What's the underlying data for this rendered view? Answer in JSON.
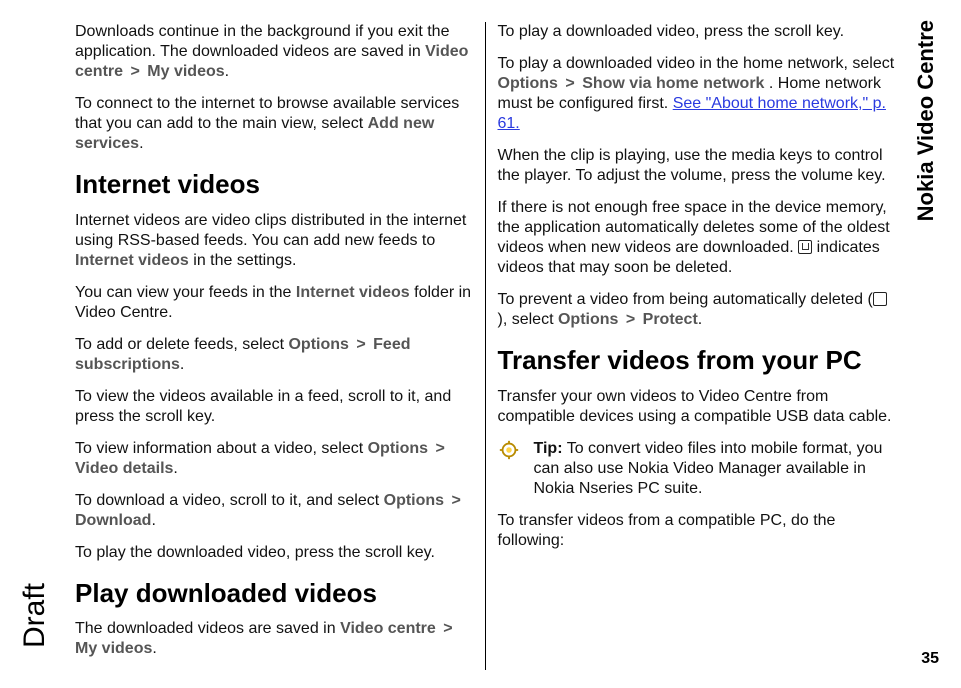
{
  "sidebar_title": "Nokia Video Centre",
  "watermark": "Draft",
  "page_number": "35",
  "left": {
    "p1_a": "Downloads continue in the background if you exit the application. The downloaded videos are saved in ",
    "p1_b": "Video centre",
    "p1_c": "My videos",
    "p1_d": ".",
    "p2_a": "To connect to the internet to browse available services that you can add to the main view, select ",
    "p2_b": "Add new services",
    "p2_c": ".",
    "h1": "Internet videos",
    "p3_a": "Internet videos are video clips distributed in the internet using RSS-based feeds. You can add new feeds to ",
    "p3_b": "Internet videos",
    "p3_c": " in the settings.",
    "p4_a": "You can view your feeds in the ",
    "p4_b": "Internet videos",
    "p4_c": " folder in Video Centre.",
    "p5_a": "To add or delete feeds, select ",
    "p5_b": "Options",
    "p5_c": "Feed subscriptions",
    "p5_d": ".",
    "p6": "To view the videos available in a feed, scroll to it, and press the scroll key.",
    "p7_a": "To view information about a video, select ",
    "p7_b": "Options",
    "p7_c": "Video details",
    "p7_d": ".",
    "p8_a": "To download a video, scroll to it, and select ",
    "p8_b": "Options",
    "p8_c": "Download",
    "p8_d": ".",
    "p9": "To play the downloaded video, press the scroll key.",
    "h2": "Play downloaded videos",
    "p10_a": "The downloaded videos are saved in ",
    "p10_b": "Video centre",
    "p10_c": "My videos",
    "p10_d": "."
  },
  "right": {
    "p1": "To play a downloaded video, press the scroll key.",
    "p2_a": "To play a downloaded video in the home network, select ",
    "p2_b": "Options",
    "p2_c": "Show via home network",
    "p2_d": ". Home network must be configured first. ",
    "p2_link": "See \"About home network,\" p. 61.",
    "p3": "When the clip is playing, use the media keys to control the player. To adjust the volume, press the volume key.",
    "p4_a": "If there is not enough free space in the device memory, the application automatically deletes some of the oldest videos when new videos are downloaded. ",
    "p4_b": " indicates videos that may soon be deleted.",
    "p5_a": "To prevent a video from being automatically deleted (",
    "p5_b": "), select ",
    "p5_c": "Options",
    "p5_d": "Protect",
    "p5_e": ".",
    "h1": "Transfer videos from your PC",
    "p6": "Transfer your own videos to Video Centre from compatible devices using a compatible USB data cable.",
    "tip_label": "Tip:",
    "tip_body": " To convert video files into mobile format, you can also use Nokia Video Manager available in Nokia Nseries PC suite.",
    "p7": "To transfer videos from a compatible PC, do the following:"
  },
  "gt": ">"
}
